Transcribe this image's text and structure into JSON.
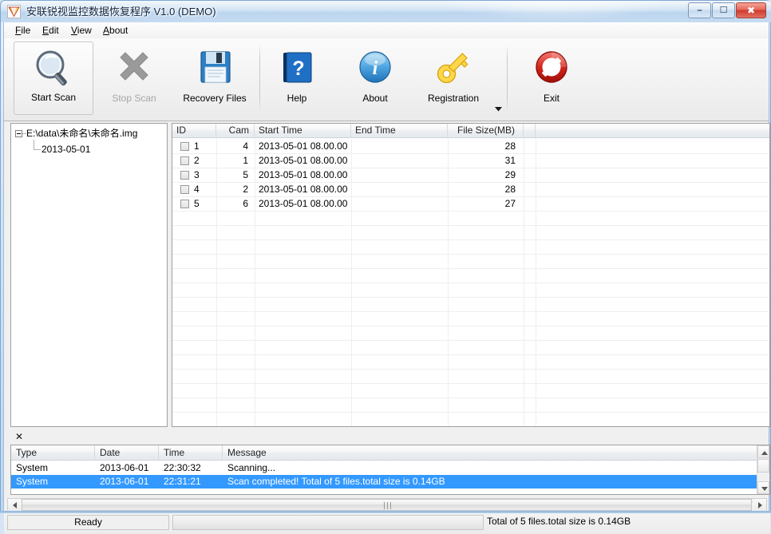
{
  "window": {
    "title": "安联锐视监控数据恢复程序 V1.0 (DEMO)",
    "icon": "app-prism-icon",
    "controls": {
      "minimize": "—",
      "maximize": "❐",
      "close": "✕"
    }
  },
  "menu": {
    "items": [
      {
        "accel": "F",
        "rest": "ile"
      },
      {
        "accel": "E",
        "rest": "dit"
      },
      {
        "accel": "V",
        "rest": "iew"
      },
      {
        "accel": "A",
        "rest": "bout"
      }
    ]
  },
  "toolbar": {
    "buttons": [
      {
        "label": "Start Scan",
        "icon": "magnifier-icon",
        "enabled": true
      },
      {
        "label": "Stop Scan",
        "icon": "x-cross-icon",
        "enabled": false
      },
      {
        "label": "Recovery  Files",
        "icon": "floppy-disk-icon",
        "enabled": true
      },
      {
        "label": "Help",
        "icon": "help-book-icon",
        "enabled": true
      },
      {
        "label": "About",
        "icon": "info-circle-icon",
        "enabled": true
      },
      {
        "label": "Registration",
        "icon": "key-icon",
        "enabled": true
      },
      {
        "label": "Exit",
        "icon": "no-entry-icon",
        "enabled": true
      }
    ],
    "dropdown_icon": "chevron-down-icon"
  },
  "tree": {
    "root": {
      "label": "E:\\data\\未命名\\未命名.img",
      "expanded": true
    },
    "children": [
      {
        "label": "2013-05-01"
      }
    ]
  },
  "file_list": {
    "columns": [
      "ID",
      "Cam",
      "Start Time",
      "End Time",
      "File Size(MB)",
      ""
    ],
    "rows": [
      {
        "id": "1",
        "cam": "4",
        "start": "2013-05-01 08.00.00",
        "end": "",
        "size": "28"
      },
      {
        "id": "2",
        "cam": "1",
        "start": "2013-05-01 08.00.00",
        "end": "",
        "size": "31"
      },
      {
        "id": "3",
        "cam": "5",
        "start": "2013-05-01 08.00.00",
        "end": "",
        "size": "29"
      },
      {
        "id": "4",
        "cam": "2",
        "start": "2013-05-01 08.00.00",
        "end": "",
        "size": "28"
      },
      {
        "id": "5",
        "cam": "6",
        "start": "2013-05-01 08.00.00",
        "end": "",
        "size": "27"
      }
    ]
  },
  "log": {
    "close_label": "✕",
    "columns": [
      "Type",
      "Date",
      "Time",
      "Message"
    ],
    "rows": [
      {
        "type": "System",
        "date": "2013-06-01",
        "time": "22:30:32",
        "message": "Scanning...",
        "selected": false
      },
      {
        "type": "System",
        "date": "2013-06-01",
        "time": "22:31:21",
        "message": "Scan completed! Total of 5 files.total size is 0.14GB",
        "selected": true
      }
    ]
  },
  "statusbar": {
    "ready": "Ready",
    "progress_percent": 0,
    "total": "Total of 5 files.total size is 0.14GB"
  },
  "colors": {
    "selection": "#3399ff",
    "title_text": "#10243f",
    "close_button": "#cf3a2c"
  }
}
